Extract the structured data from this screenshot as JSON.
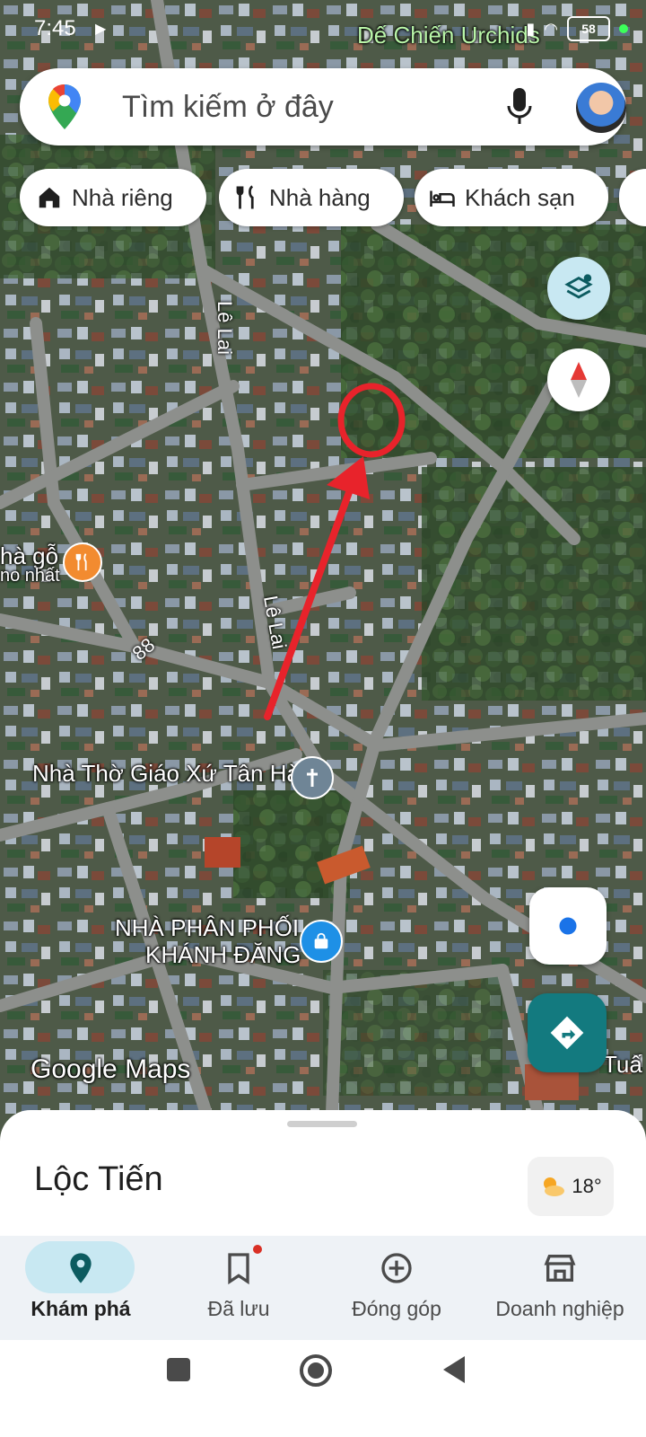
{
  "status_bar": {
    "time": "7:45",
    "battery": "58"
  },
  "map": {
    "top_place": "Dế Chiến Urchids",
    "labels": {
      "restaurant_partial_1": "hà gỗ",
      "restaurant_partial_2": "no nhất",
      "church": "Nhà Thờ Giáo Xứ Tân Hà",
      "distributor_1": "NHÀ PHÂN PHỐI",
      "distributor_2": "KHÁNH ĐĂNG",
      "edge_partial": "Tuấ",
      "watermark": "Google Maps"
    },
    "roads": {
      "le_lai_1": "Lê Lai",
      "le_lai_2": "Lê Lai",
      "route_88": "88"
    }
  },
  "search": {
    "placeholder": "Tìm kiếm ở đây"
  },
  "chips": [
    {
      "label": "Nhà riêng",
      "icon": "home-icon"
    },
    {
      "label": "Nhà hàng",
      "icon": "restaurant-icon"
    },
    {
      "label": "Khách sạn",
      "icon": "hotel-icon"
    }
  ],
  "sheet": {
    "title": "Lộc Tiến",
    "weather": "18°"
  },
  "bottom_nav": [
    {
      "label": "Khám phá",
      "icon": "explore-pin-icon",
      "active": true
    },
    {
      "label": "Đã lưu",
      "icon": "bookmark-icon",
      "active": false
    },
    {
      "label": "Đóng góp",
      "icon": "add-circle-icon",
      "active": false
    },
    {
      "label": "Doanh nghiệp",
      "icon": "storefront-icon",
      "active": false
    }
  ],
  "colors": {
    "accent_teal": "#137a7f",
    "annotation_red": "#e8232b",
    "active_pill": "#c8e8f2"
  }
}
